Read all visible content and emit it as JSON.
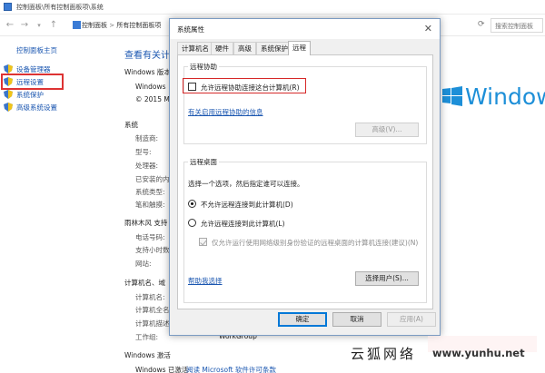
{
  "cp": {
    "title": "控制面板\\所有控制面板项\\系统",
    "address": [
      "控制面板",
      "所有控制面板项"
    ],
    "search_placeholder": "搜索控制面板",
    "left": {
      "home": "控制面板主页",
      "links": [
        "设备管理器",
        "远程设置",
        "系统保护",
        "高级系统设置"
      ]
    },
    "main": {
      "heading": "查看有关计",
      "edition_label": "Windows 版本",
      "edition_lines": [
        "Windows",
        "© 2015 M"
      ],
      "system_label": "系统",
      "system_rows": [
        "制造商:",
        "型号:",
        "处理器:",
        "已安装的内",
        "系统类型:",
        "笔和触摸:"
      ],
      "support_label": "雨林木风 支持",
      "support_rows": [
        "电话号码:",
        "支持小时数",
        "网站:"
      ],
      "computer_label": "计算机名、域",
      "computer_rows": [
        "计算机名:",
        "计算机全名",
        "计算机描述",
        "工作组:"
      ],
      "workgroup": "WorkGroup",
      "activation_label": "Windows 激活",
      "activation_status": "Windows 已激活",
      "activation_link": "阅读 Microsoft 软件许可条款",
      "logo_text": "Window"
    }
  },
  "dialog": {
    "title": "系统属性",
    "close": "✕",
    "tabs": [
      "计算机名",
      "硬件",
      "高级",
      "系统保护",
      "远程"
    ],
    "active_tab": "远程",
    "remote_assist": {
      "group_title": "远程协助",
      "checkbox_label": "允许远程协助连接这台计算机(R)",
      "link": "有关启用远程协助的信息",
      "advanced_button": "高级(V)..."
    },
    "remote_desktop": {
      "group_title": "远程桌面",
      "instruction": "选择一个选项，然后指定谁可以连接。",
      "radio_deny": "不允许远程连接到此计算机(D)",
      "radio_allow": "允许远程连接到此计算机(L)",
      "nla_label": "仅允许运行使用网络级别身份验证的远程桌面的计算机连接(建议)(N)",
      "help_link": "帮助我选择",
      "select_users_button": "选择用户(S)..."
    },
    "buttons": {
      "ok": "确定",
      "cancel": "取消",
      "apply": "应用(A)"
    }
  },
  "watermark": {
    "text_cn": "云狐网络",
    "url": "www.yunhu.net"
  }
}
